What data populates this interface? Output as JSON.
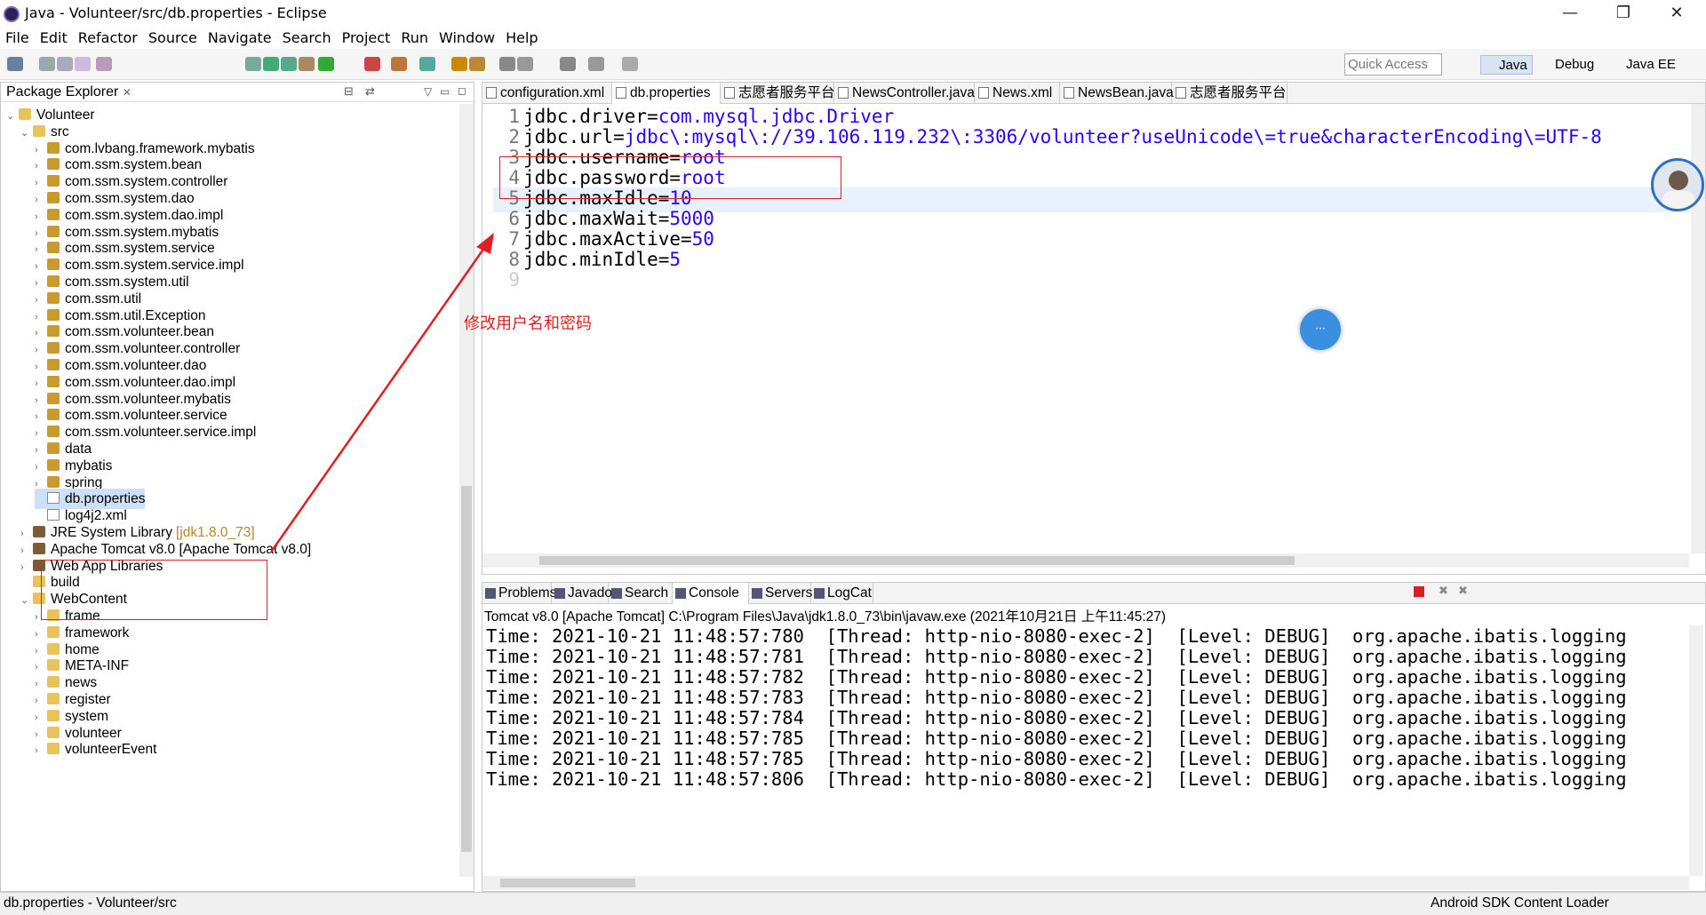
{
  "window": {
    "title": "Java - Volunteer/src/db.properties - Eclipse",
    "minimize": "—",
    "restore": "❐",
    "close": "✕"
  },
  "menu": [
    "File",
    "Edit",
    "Refactor",
    "Source",
    "Navigate",
    "Search",
    "Project",
    "Run",
    "Window",
    "Help"
  ],
  "toolbar": {
    "quick_access_placeholder": "Quick Access",
    "perspectives": [
      "Java",
      "Debug",
      "Java EE"
    ]
  },
  "package_explorer": {
    "title": "Package Explorer",
    "tree": [
      {
        "label": "Volunteer",
        "level": 0,
        "expanded": true,
        "kind": "project"
      },
      {
        "label": "src",
        "level": 1,
        "expanded": true,
        "kind": "srcfolder"
      },
      {
        "label": "com.lvbang.framework.mybatis",
        "level": 2,
        "kind": "package"
      },
      {
        "label": "com.ssm.system.bean",
        "level": 2,
        "kind": "package"
      },
      {
        "label": "com.ssm.system.controller",
        "level": 2,
        "kind": "package"
      },
      {
        "label": "com.ssm.system.dao",
        "level": 2,
        "kind": "package"
      },
      {
        "label": "com.ssm.system.dao.impl",
        "level": 2,
        "kind": "package"
      },
      {
        "label": "com.ssm.system.mybatis",
        "level": 2,
        "kind": "package"
      },
      {
        "label": "com.ssm.system.service",
        "level": 2,
        "kind": "package"
      },
      {
        "label": "com.ssm.system.service.impl",
        "level": 2,
        "kind": "package"
      },
      {
        "label": "com.ssm.system.util",
        "level": 2,
        "kind": "package"
      },
      {
        "label": "com.ssm.util",
        "level": 2,
        "kind": "package"
      },
      {
        "label": "com.ssm.util.Exception",
        "level": 2,
        "kind": "package"
      },
      {
        "label": "com.ssm.volunteer.bean",
        "level": 2,
        "kind": "package"
      },
      {
        "label": "com.ssm.volunteer.controller",
        "level": 2,
        "kind": "package"
      },
      {
        "label": "com.ssm.volunteer.dao",
        "level": 2,
        "kind": "package"
      },
      {
        "label": "com.ssm.volunteer.dao.impl",
        "level": 2,
        "kind": "package"
      },
      {
        "label": "com.ssm.volunteer.mybatis",
        "level": 2,
        "kind": "package"
      },
      {
        "label": "com.ssm.volunteer.service",
        "level": 2,
        "kind": "package"
      },
      {
        "label": "com.ssm.volunteer.service.impl",
        "level": 2,
        "kind": "package"
      },
      {
        "label": "data",
        "level": 2,
        "kind": "package"
      },
      {
        "label": "mybatis",
        "level": 2,
        "kind": "package"
      },
      {
        "label": "spring",
        "level": 2,
        "kind": "package"
      },
      {
        "label": "db.properties",
        "level": 2,
        "kind": "file",
        "selected": true
      },
      {
        "label": "log4j2.xml",
        "level": 2,
        "kind": "file"
      },
      {
        "label": "JRE System Library",
        "suffix": "[jdk1.8.0_73]",
        "level": 1,
        "kind": "lib"
      },
      {
        "label": "Apache Tomcat v8.0 [Apache Tomcat v8.0]",
        "level": 1,
        "kind": "lib"
      },
      {
        "label": "Web App Libraries",
        "level": 1,
        "kind": "lib"
      },
      {
        "label": "build",
        "level": 1,
        "kind": "folder",
        "leaf": true
      },
      {
        "label": "WebContent",
        "level": 1,
        "expanded": true,
        "kind": "folder"
      },
      {
        "label": "frame",
        "level": 2,
        "kind": "folder"
      },
      {
        "label": "framework",
        "level": 2,
        "kind": "folder"
      },
      {
        "label": "home",
        "level": 2,
        "kind": "folder"
      },
      {
        "label": "META-INF",
        "level": 2,
        "kind": "folder"
      },
      {
        "label": "news",
        "level": 2,
        "kind": "folder"
      },
      {
        "label": "register",
        "level": 2,
        "kind": "folder"
      },
      {
        "label": "system",
        "level": 2,
        "kind": "folder"
      },
      {
        "label": "volunteer",
        "level": 2,
        "kind": "folder"
      },
      {
        "label": "volunteerEvent",
        "level": 2,
        "kind": "folder"
      }
    ]
  },
  "editor": {
    "tabs": [
      "configuration.xml",
      "db.properties",
      "志愿者服务平台",
      "NewsController.java",
      "News.xml",
      "NewsBean.java",
      "志愿者服务平台"
    ],
    "active_tab": 1,
    "current_line": 5,
    "lines": [
      {
        "n": "1",
        "key": "jdbc.driver=",
        "val": "com.mysql.jdbc.Driver"
      },
      {
        "n": "2",
        "key": "jdbc.url=",
        "val": "jdbc\\:mysql\\://39.106.119.232\\:3306/volunteer?useUnicode\\=true&characterEncoding\\=UTF-8"
      },
      {
        "n": "3",
        "key": "jdbc.username=",
        "val": "root"
      },
      {
        "n": "4",
        "key": "jdbc.password=",
        "val": "root"
      },
      {
        "n": "5",
        "key": "jdbc.maxIdle=",
        "val": "10"
      },
      {
        "n": "6",
        "key": "jdbc.maxWait=",
        "val": "5000"
      },
      {
        "n": "7",
        "key": "jdbc.maxActive=",
        "val": "50"
      },
      {
        "n": "8",
        "key": "jdbc.minIdle=",
        "val": "5"
      },
      {
        "n": "9",
        "key": "",
        "val": ""
      }
    ]
  },
  "annotation": {
    "text": "修改用户名和密码",
    "color": "#e02020"
  },
  "console_panel": {
    "tabs": [
      "Problems",
      "Javadoc",
      "Search",
      "Console",
      "Servers",
      "LogCat"
    ],
    "active_tab": 3,
    "description": "Tomcat v8.0  [Apache Tomcat] C:\\Program Files\\Java\\jdk1.8.0_73\\bin\\javaw.exe (2021年10月21日 上午11:45:27)",
    "lines": [
      "Time: 2021-10-21 11:48:57:780  [Thread: http-nio-8080-exec-2]  [Level: DEBUG]  org.apache.ibatis.logging",
      "Time: 2021-10-21 11:48:57:781  [Thread: http-nio-8080-exec-2]  [Level: DEBUG]  org.apache.ibatis.logging",
      "Time: 2021-10-21 11:48:57:782  [Thread: http-nio-8080-exec-2]  [Level: DEBUG]  org.apache.ibatis.logging",
      "Time: 2021-10-21 11:48:57:783  [Thread: http-nio-8080-exec-2]  [Level: DEBUG]  org.apache.ibatis.logging",
      "Time: 2021-10-21 11:48:57:784  [Thread: http-nio-8080-exec-2]  [Level: DEBUG]  org.apache.ibatis.logging",
      "Time: 2021-10-21 11:48:57:785  [Thread: http-nio-8080-exec-2]  [Level: DEBUG]  org.apache.ibatis.logging",
      "Time: 2021-10-21 11:48:57:785  [Thread: http-nio-8080-exec-2]  [Level: DEBUG]  org.apache.ibatis.logging",
      "Time: 2021-10-21 11:48:57:806  [Thread: http-nio-8080-exec-2]  [Level: DEBUG]  org.apache.ibatis.logging"
    ]
  },
  "status_bar": {
    "left": "db.properties - Volunteer/src",
    "right": "Android SDK Content Loader"
  },
  "colors": {
    "accent": "#2a00ff",
    "selection": "#cce1f7",
    "annotation": "#e02020",
    "current_line": "#e8f2fe"
  }
}
